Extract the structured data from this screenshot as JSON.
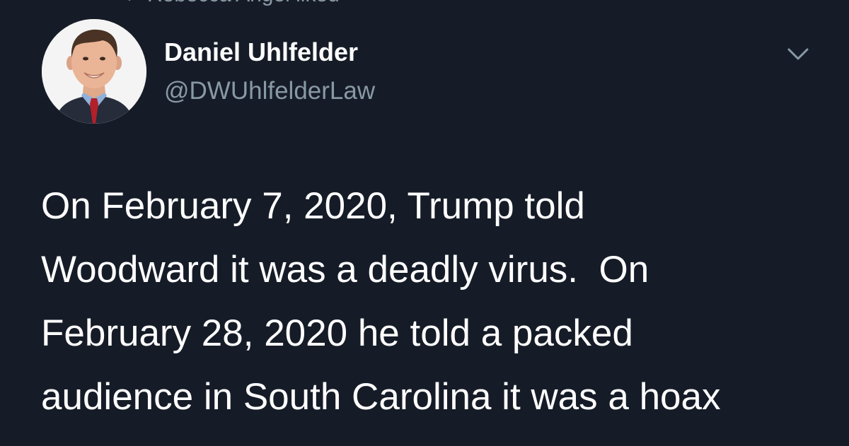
{
  "context": {
    "label": "Rebecca Angel liked",
    "icon": "heart-icon"
  },
  "author": {
    "display_name": "Daniel Uhlfelder",
    "handle": "@DWUhlfelderLaw",
    "avatar_icon": "profile-photo"
  },
  "menu": {
    "icon": "chevron-down-icon"
  },
  "tweet": {
    "lines": [
      "On February 7, 2020, Trump told",
      "Woodward it was a deadly virus.  On",
      "February 28, 2020 he told a packed",
      "audience in South Carolina it was a hoax"
    ]
  },
  "colors": {
    "background": "#161c27",
    "primary_text": "#ffffff",
    "secondary_text": "#8899a6"
  }
}
